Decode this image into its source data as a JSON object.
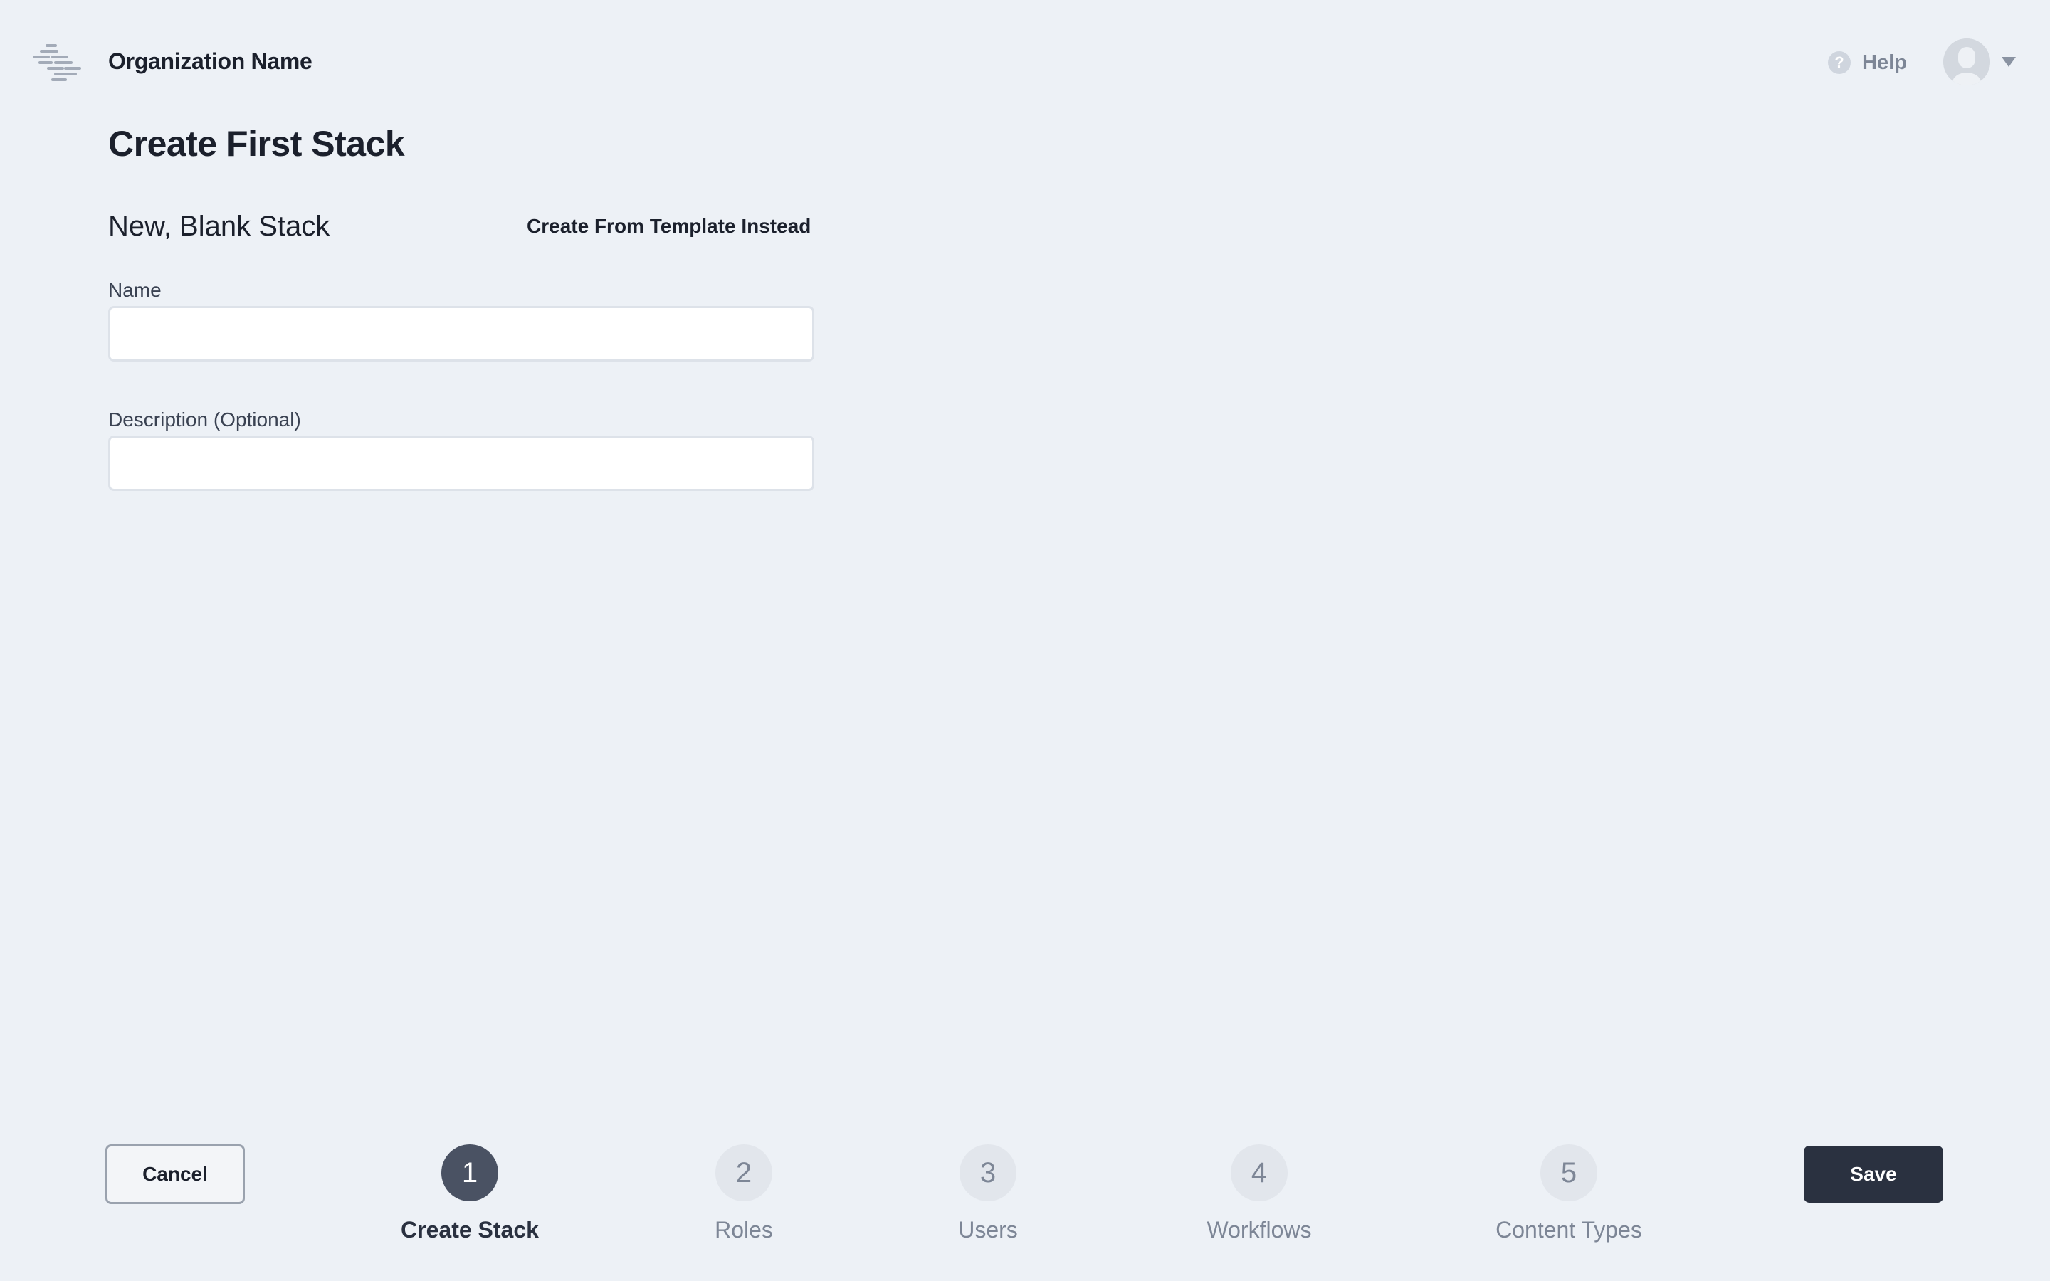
{
  "header": {
    "org_name": "Organization Name",
    "help_label": "Help",
    "help_icon": "?",
    "logo_icon": "stacked-lines-logo",
    "avatar_icon": "user-avatar",
    "menu_icon": "chevron-down"
  },
  "main": {
    "page_title": "Create First Stack",
    "section_title": "New, Blank Stack",
    "template_link": "Create From Template Instead",
    "fields": {
      "name": {
        "label": "Name",
        "value": "",
        "placeholder": ""
      },
      "description": {
        "label": "Description (Optional)",
        "value": "",
        "placeholder": ""
      }
    }
  },
  "footer": {
    "cancel_label": "Cancel",
    "save_label": "Save",
    "steps": [
      {
        "number": "1",
        "label": "Create Stack",
        "active": true
      },
      {
        "number": "2",
        "label": "Roles",
        "active": false
      },
      {
        "number": "3",
        "label": "Users",
        "active": false
      },
      {
        "number": "4",
        "label": "Workflows",
        "active": false
      },
      {
        "number": "5",
        "label": "Content Types",
        "active": false
      }
    ]
  },
  "colors": {
    "background": "#edf1f6",
    "text_primary": "#1b202c",
    "text_muted": "#7d8696",
    "step_active": "#4a5263",
    "step_inactive": "#e2e6ec",
    "save_button": "#2a3140",
    "input_border": "#dde2e9"
  }
}
